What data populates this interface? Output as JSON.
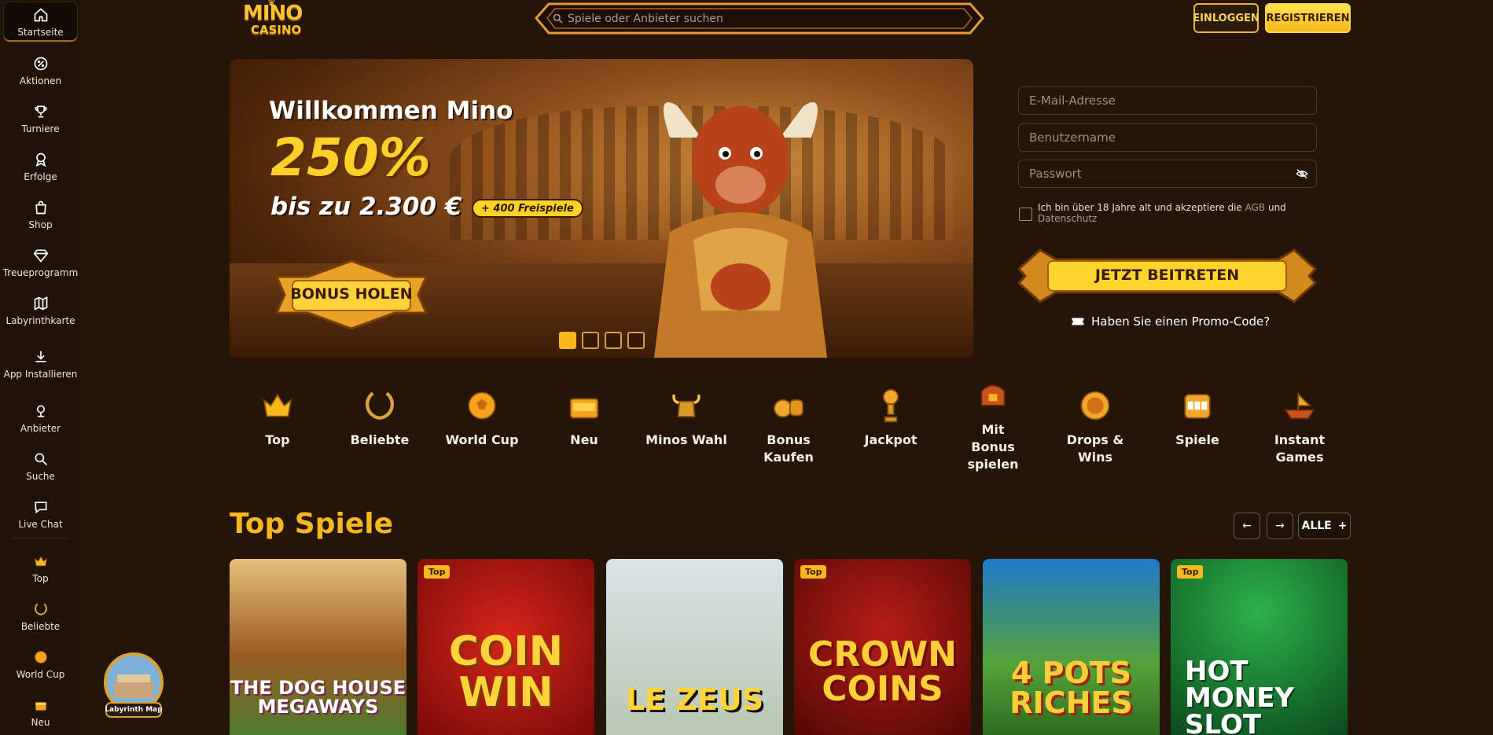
{
  "sidebar": {
    "items": [
      {
        "label": "Startseite",
        "icon": "home-icon"
      },
      {
        "label": "Aktionen",
        "icon": "percent-icon"
      },
      {
        "label": "Turniere",
        "icon": "trophy-icon"
      },
      {
        "label": "Erfolge",
        "icon": "award-icon"
      },
      {
        "label": "Shop",
        "icon": "shopping-bag-icon"
      },
      {
        "label": "Treueprogramm",
        "icon": "diamond-icon"
      },
      {
        "label": "Labyrinthkarte",
        "icon": "map-icon"
      },
      {
        "label": "App Installieren",
        "icon": "download-icon"
      },
      {
        "label": "Anbieter",
        "icon": "provider-icon"
      },
      {
        "label": "Suche",
        "icon": "search-icon"
      },
      {
        "label": "Live Chat",
        "icon": "chat-icon"
      }
    ],
    "categories": [
      {
        "label": "Top",
        "icon": "crown-icon"
      },
      {
        "label": "Beliebte",
        "icon": "laurel-icon"
      },
      {
        "label": "World Cup",
        "icon": "ball-icon"
      },
      {
        "label": "Neu",
        "icon": "new-chest-icon"
      }
    ],
    "lab_map_label": "Labyrinth Map"
  },
  "header": {
    "logo_top": "MINO",
    "logo_bottom": "CASINO",
    "search_placeholder": "Spiele oder Anbieter suchen",
    "login_label": "EINLOGGEN",
    "register_label": "REGISTRIEREN"
  },
  "banner": {
    "welcome": "Willkommen Mino",
    "percent": "250%",
    "up_to": "bis zu 2.300 €",
    "free_spins": "+ 400 Freispiele",
    "cta": "BONUS HOLEN",
    "slides_total": 4,
    "slide_active": 1
  },
  "register": {
    "email_placeholder": "E-Mail-Adresse",
    "username_placeholder": "Benutzername",
    "password_placeholder": "Passwort",
    "terms_prefix": "Ich bin über 18 Jahre alt und akzeptiere die ",
    "terms_link1": "AGB",
    "terms_mid": " und ",
    "terms_link2": "Datenschutz",
    "join_label": "JETZT BEITRETEN",
    "promo_label": "Haben Sie einen Promo-Code?"
  },
  "categories": [
    {
      "label": "Top",
      "icon": "crown-icon"
    },
    {
      "label": "Beliebte",
      "icon": "laurel-icon"
    },
    {
      "label": "World Cup",
      "icon": "ball-icon"
    },
    {
      "label": "Neu",
      "icon": "new-chest-icon"
    },
    {
      "label": "Minos Wahl",
      "icon": "bull-helmet-icon"
    },
    {
      "label": "Bonus Kaufen",
      "icon": "coins-icon"
    },
    {
      "label": "Jackpot",
      "icon": "jackpot-trophy-icon"
    },
    {
      "label": "Mit Bonus spielen",
      "icon": "bonus-chest-icon"
    },
    {
      "label": "Drops & Wins",
      "icon": "drops-wins-icon"
    },
    {
      "label": "Spiele",
      "icon": "slot-machine-icon"
    },
    {
      "label": "Instant Games",
      "icon": "ship-icon"
    }
  ],
  "top_games": {
    "title": "Top Spiele",
    "all_label": "ALLE",
    "games": [
      {
        "title": "THE DOG HOUSE MEGAWAYS",
        "tag": ""
      },
      {
        "title": "COIN WIN",
        "tag": "Top"
      },
      {
        "title": "LE ZEUS",
        "tag": ""
      },
      {
        "title": "CROWN COINS",
        "tag": "Top"
      },
      {
        "title": "4 POTS RICHES",
        "tag": ""
      },
      {
        "title": "HOT MONEY SLOT",
        "tag": "Top"
      }
    ]
  },
  "colors": {
    "background": "#241508",
    "accent": "#f7b81e",
    "sidebar": "#1f1206"
  }
}
